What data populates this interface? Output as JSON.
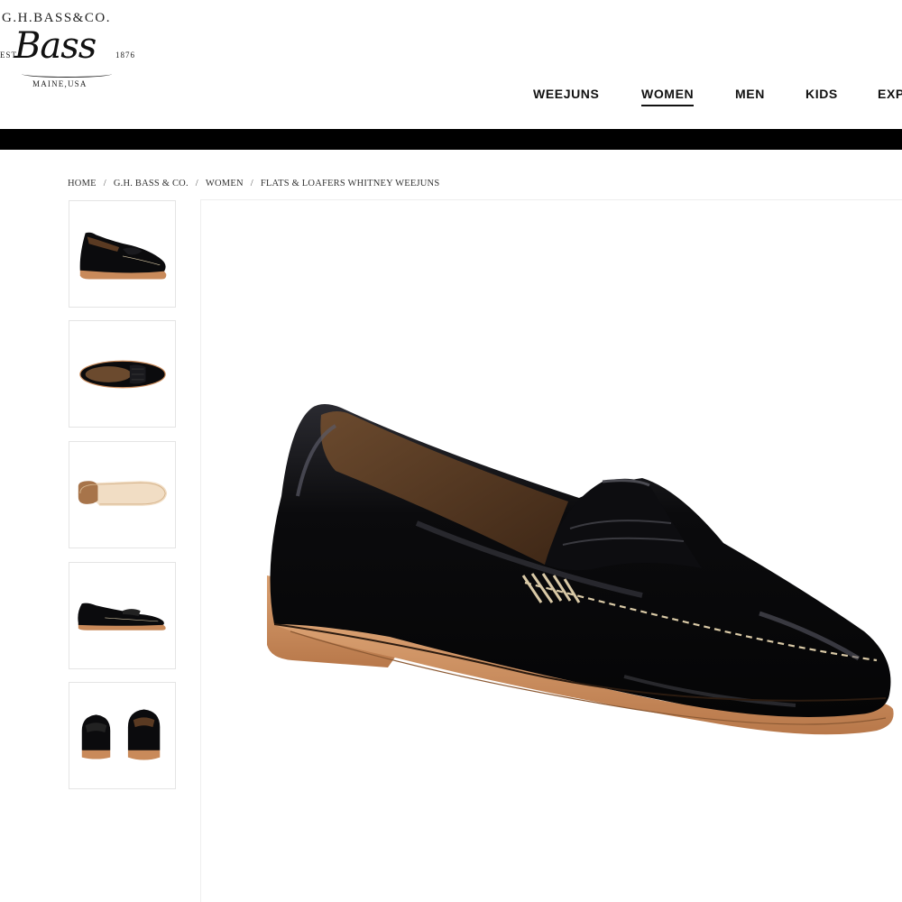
{
  "brand": {
    "top_line": "G.H.BASS&CO.",
    "script_name": "Bass",
    "est_left": "EST.",
    "est_year": "1876",
    "location": "MAINE,USA"
  },
  "nav": {
    "items": [
      {
        "label": "WEEJUNS",
        "active": false
      },
      {
        "label": "WOMEN",
        "active": true
      },
      {
        "label": "MEN",
        "active": false
      },
      {
        "label": "KIDS",
        "active": false
      },
      {
        "label": "EXP",
        "active": false
      }
    ]
  },
  "breadcrumb": {
    "items": [
      "HOME",
      "G.H. BASS & CO.",
      "WOMEN",
      "FLATS & LOAFERS WHITNEY WEEJUNS"
    ],
    "separator": "/"
  },
  "product": {
    "thumbnails": [
      "loafer-side-view",
      "loafer-top-view",
      "loafer-sole-view",
      "loafer-side-low-view",
      "loafer-pair-front-back-view"
    ],
    "main_image": "black-patent-penny-loafer-three-quarter-view",
    "colors": {
      "upper": "#0b0b0d",
      "lining": "#5a3a22",
      "sole": "#c98a5a",
      "stitch": "#d9c9a6"
    }
  }
}
